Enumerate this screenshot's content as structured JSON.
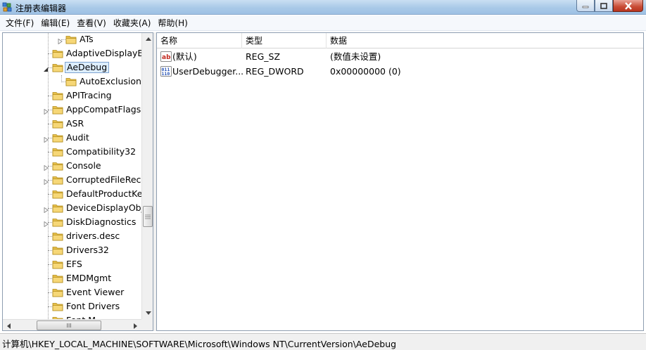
{
  "window": {
    "title": "注册表编辑器"
  },
  "menu": [
    "文件(F)",
    "编辑(E)",
    "查看(V)",
    "收藏夹(A)",
    "帮助(H)"
  ],
  "tree": {
    "items": [
      {
        "label": "ATs",
        "expander": "collapsed",
        "depth": 2
      },
      {
        "label": "AdaptiveDisplayBr",
        "expander": "none",
        "depth": 1
      },
      {
        "label": "AeDebug",
        "expander": "expanded",
        "depth": 1,
        "selected": true
      },
      {
        "label": "AutoExclusionL",
        "expander": "none",
        "depth": 2
      },
      {
        "label": "APITracing",
        "expander": "none",
        "depth": 1
      },
      {
        "label": "AppCompatFlags",
        "expander": "collapsed",
        "depth": 1
      },
      {
        "label": "ASR",
        "expander": "none",
        "depth": 1
      },
      {
        "label": "Audit",
        "expander": "collapsed",
        "depth": 1
      },
      {
        "label": "Compatibility32",
        "expander": "none",
        "depth": 1
      },
      {
        "label": "Console",
        "expander": "collapsed",
        "depth": 1
      },
      {
        "label": "CorruptedFileReco",
        "expander": "collapsed",
        "depth": 1
      },
      {
        "label": "DefaultProductKey",
        "expander": "none",
        "depth": 1
      },
      {
        "label": "DeviceDisplayObje",
        "expander": "collapsed",
        "depth": 1
      },
      {
        "label": "DiskDiagnostics",
        "expander": "collapsed",
        "depth": 1
      },
      {
        "label": "drivers.desc",
        "expander": "none",
        "depth": 1
      },
      {
        "label": "Drivers32",
        "expander": "none",
        "depth": 1
      },
      {
        "label": "EFS",
        "expander": "none",
        "depth": 1
      },
      {
        "label": "EMDMgmt",
        "expander": "none",
        "depth": 1
      },
      {
        "label": "Event Viewer",
        "expander": "none",
        "depth": 1
      },
      {
        "label": "Font Drivers",
        "expander": "none",
        "depth": 1
      },
      {
        "label": "Font M",
        "expander": "none",
        "depth": 1
      }
    ],
    "hscroll_thumb_glyph": "III"
  },
  "list": {
    "columns": [
      "名称",
      "类型",
      "数据"
    ],
    "rows": [
      {
        "name": "(默认)",
        "type": "REG_SZ",
        "data": "(数值未设置)",
        "icon": "string-value-icon"
      },
      {
        "name": "UserDebugger...",
        "type": "REG_DWORD",
        "data": "0x00000000 (0)",
        "icon": "binary-value-icon"
      }
    ]
  },
  "status": {
    "path": "计算机\\HKEY_LOCAL_MACHINE\\SOFTWARE\\Microsoft\\Windows NT\\CurrentVersion\\AeDebug"
  },
  "colors": {
    "folder": "#e8c04a",
    "selection": "#ddeeff",
    "close": "#c84b35"
  }
}
